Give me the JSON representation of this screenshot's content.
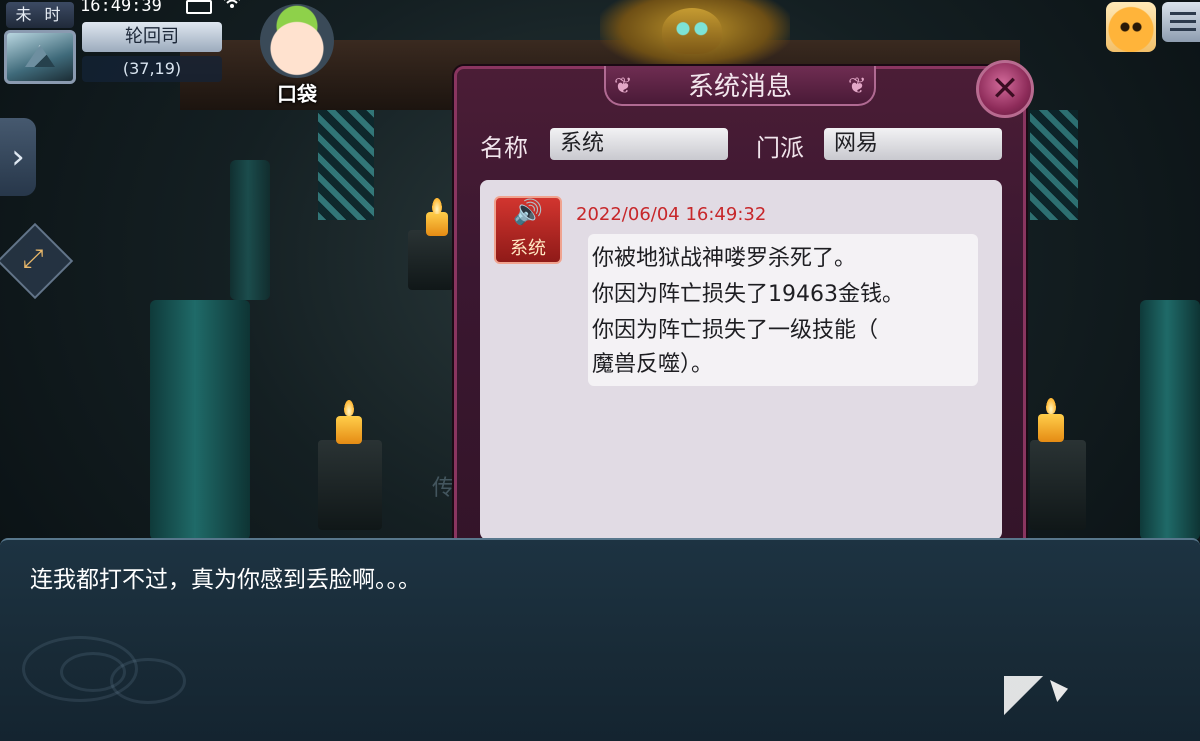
{
  "status_bar": {
    "time_period": "未 时",
    "clock": "16:49:39"
  },
  "location": {
    "name": "轮回司",
    "coords": "(37,19)"
  },
  "bag": {
    "label": "口袋"
  },
  "scene": {
    "faded_char": "传"
  },
  "system_dialog": {
    "title": "系统消息",
    "close_glyph": "✕",
    "name_label": "名称",
    "name_value": "系统",
    "faction_label": "门派",
    "faction_value": "网易",
    "sender_label": "系统",
    "speaker_icon": "🔊",
    "timestamp": "2022/06/04  16:49:32",
    "message_lines": [
      "你被地狱战神喽罗杀死了。",
      "你因为阵亡损失了19463金钱。",
      "你因为阵亡损失了一级技能（",
      "魔兽反噬）。"
    ]
  },
  "npc_dialogue": {
    "text": "连我都打不过，真为你感到丢脸啊。。。"
  },
  "controls": {
    "side_arrow": "›",
    "expand_glyph": "⤢"
  }
}
